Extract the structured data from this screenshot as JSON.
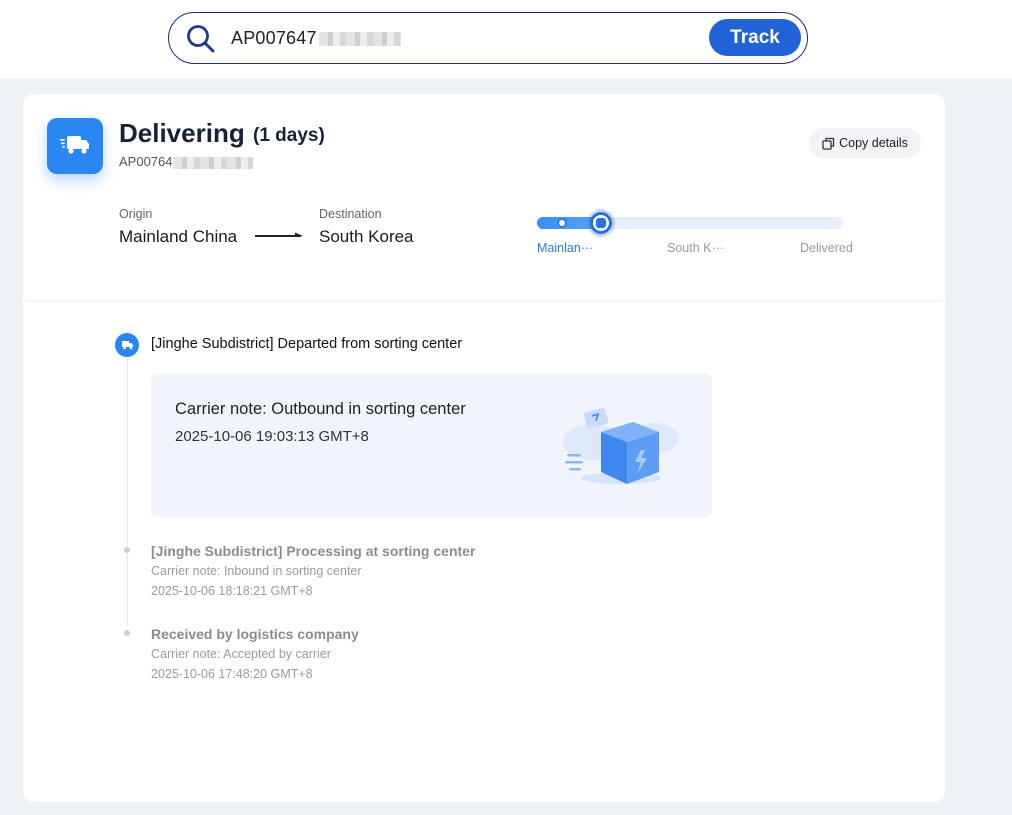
{
  "search": {
    "value": "AP007647",
    "button_label": "Track"
  },
  "shipment": {
    "status": "Delivering",
    "days": "(1 days)",
    "tracking_number": "AP00764",
    "copy_label": "Copy details",
    "origin_label": "Origin",
    "origin": "Mainland China",
    "destination_label": "Destination",
    "destination": "South Korea"
  },
  "progress": {
    "steps": [
      "Mainlan···",
      "South K···",
      "Delivered"
    ],
    "active_step": 0,
    "fill_fraction": 0.22
  },
  "events": [
    {
      "title": "[Jinghe Subdistrict] Departed from sorting center",
      "note": "Carrier note: Outbound in sorting center",
      "time": "2025-10-06 19:03:13 GMT+8"
    },
    {
      "title": "[Jinghe Subdistrict] Processing at sorting center",
      "note": "Carrier note: Inbound in sorting center",
      "time": "2025-10-06 18:18:21 GMT+8"
    },
    {
      "title": "Received by logistics company",
      "note": "Carrier note: Accepted by carrier",
      "time": "2025-10-06 17:48:20 GMT+8"
    }
  ],
  "icons": {
    "search": "search-icon",
    "status": "delivery-truck-icon",
    "copy": "copy-icon",
    "arrow": "arrow-right-icon",
    "timeline": "truck-icon",
    "illustration": "package-box-icon"
  },
  "colors": {
    "accent": "#1f63d7",
    "status_icon": "#2a86f0",
    "note_bg": "#eff4fd"
  }
}
